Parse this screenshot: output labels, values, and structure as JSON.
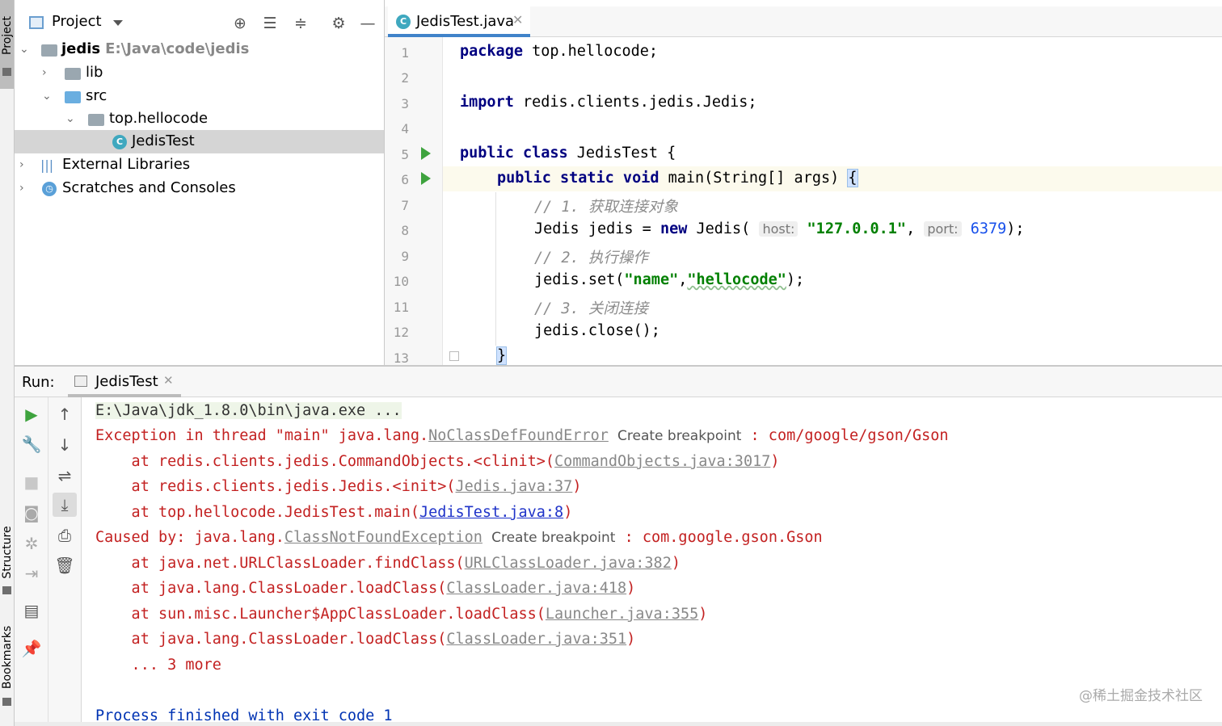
{
  "left_strip": {
    "project": "Project",
    "structure": "Structure",
    "bookmarks": "Bookmarks"
  },
  "project_panel": {
    "title": "Project",
    "toolbar": [
      "locate-icon",
      "expand-all-icon",
      "collapse-all-icon",
      "gear-icon",
      "minimize-icon"
    ],
    "tree": [
      {
        "label": "jedis",
        "path": "E:\\Java\\code\\jedis"
      },
      {
        "label": "lib"
      },
      {
        "label": "src"
      },
      {
        "label": "top.hellocode"
      },
      {
        "label": "JedisTest"
      },
      {
        "label": "External Libraries"
      },
      {
        "label": "Scratches and Consoles"
      }
    ]
  },
  "editor": {
    "tab_label": "JedisTest.java",
    "line_numbers": [
      "1",
      "2",
      "3",
      "4",
      "5",
      "6",
      "7",
      "8",
      "9",
      "10",
      "11",
      "12",
      "13"
    ],
    "lines": {
      "l1_kw": "package",
      "l1_rest": " top.hellocode;",
      "l3_kw": "import",
      "l3_rest": " redis.clients.jedis.Jedis;",
      "l5_kw": "public class",
      "l5_rest": " JedisTest {",
      "l6_kw": "public static void",
      "l6_rest": " main(String[] args) ",
      "l6_brace": "{",
      "l7": "// 1. 获取连接对象",
      "l8_a": "Jedis jedis = ",
      "l8_new": "new",
      "l8_b": " Jedis( ",
      "l8_host_hint": "host:",
      "l8_host": "\"127.0.0.1\"",
      "l8_c": ", ",
      "l8_port_hint": "port:",
      "l8_port": "6379",
      "l8_d": ");",
      "l9": "// 2. 执行操作",
      "l10_a": "jedis.set(",
      "l10_s1": "\"name\"",
      "l10_b": ",",
      "l10_s2": "\"hellocode\"",
      "l10_c": ");",
      "l11": "// 3. 关闭连接",
      "l12": "jedis.close();",
      "l13": "}"
    }
  },
  "run_panel": {
    "title": "Run:",
    "tab_label": "JedisTest",
    "left_tools": [
      "run-icon",
      "wrench-icon",
      "stop-icon",
      "camera-icon",
      "debug-icon",
      "login-icon",
      "layout-icon",
      "pin-icon"
    ],
    "right_tools": [
      "up-arrow-icon",
      "down-arrow-icon",
      "soft-wrap-icon",
      "scroll-end-icon",
      "print-icon",
      "trash-icon"
    ],
    "console": {
      "cmd": "E:\\Java\\jdk_1.8.0\\bin\\java.exe ...",
      "ex_a": "Exception in thread \"main\" java.lang.",
      "ex_link": "NoClassDefFoundError",
      "ex_bp": "Create breakpoint",
      "ex_b": " : com/google/gson/Gson",
      "t1_a": "    at redis.clients.jedis.CommandObjects.<clinit>(",
      "t1_link": "CommandObjects.java:3017",
      "t1_b": ")",
      "t2_a": "    at redis.clients.jedis.Jedis.<init>(",
      "t2_link": "Jedis.java:37",
      "t2_b": ")",
      "t3_a": "    at top.hellocode.JedisTest.main(",
      "t3_link": "JedisTest.java:8",
      "t3_b": ")",
      "cb_a": "Caused by: java.lang.",
      "cb_link": "ClassNotFoundException",
      "cb_bp": "Create breakpoint",
      "cb_b": " : com.google.gson.Gson",
      "t4_a": "    at java.net.URLClassLoader.findClass(",
      "t4_link": "URLClassLoader.java:382",
      "t4_b": ")",
      "t5_a": "    at java.lang.ClassLoader.loadClass(",
      "t5_link": "ClassLoader.java:418",
      "t5_b": ")",
      "t6_a": "    at sun.misc.Launcher$AppClassLoader.loadClass(",
      "t6_link": "Launcher.java:355",
      "t6_b": ")",
      "t7_a": "    at java.lang.ClassLoader.loadClass(",
      "t7_link": "ClassLoader.java:351",
      "t7_b": ")",
      "more": "    ... 3 more",
      "finished": "Process finished with exit code 1"
    },
    "watermark": "@稀土掘金技术社区"
  }
}
